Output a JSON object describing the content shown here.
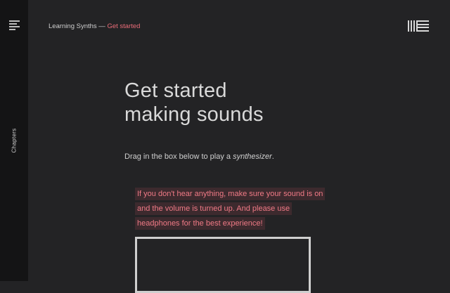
{
  "sidebar": {
    "menu_icon": "hamburger-menu-icon",
    "chapters_label": "Chapters"
  },
  "header": {
    "breadcrumb_parent": "Learning Synths",
    "breadcrumb_separator": " — ",
    "breadcrumb_current": "Get started",
    "logo_icon": "ableton-logo-icon"
  },
  "content": {
    "title_line1": "Get started",
    "title_line2": "making sounds",
    "intro_before": "Drag in the box below to play a ",
    "intro_emphasis": "synthesizer",
    "intro_after": ".",
    "warning": "If you don't hear anything, make sure your sound is on and the volume is turned up. And please use headphones for the best experience!"
  },
  "colors": {
    "background": "#232325",
    "sidebar": "#141415",
    "accent": "#e96c78",
    "warning_text": "#f07a86",
    "warning_highlight": "#3d2a2e"
  }
}
